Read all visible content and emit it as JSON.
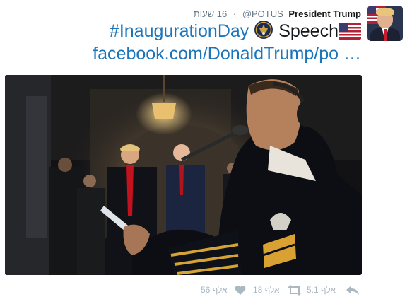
{
  "tweet": {
    "display_name": "President Trump",
    "handle": "@POTUS",
    "separator": "·",
    "time": "16 שעות",
    "hashtag": "#InaugurationDay",
    "speech_word": "Speech",
    "link_text": "facebook.com/DonaldTrump/po …"
  },
  "actions": {
    "reply_count": "",
    "retweet_count": "5.1 אלף",
    "like_count": "18 אלף",
    "extra_count": "56 אלף"
  },
  "colors": {
    "link": "#1b75bb",
    "secondary": "#657786",
    "action_icon": "#aab8c2"
  },
  "icons": [
    "presidential-seal-icon",
    "us-flag-icon",
    "reply-icon",
    "retweet-icon",
    "like-icon"
  ]
}
